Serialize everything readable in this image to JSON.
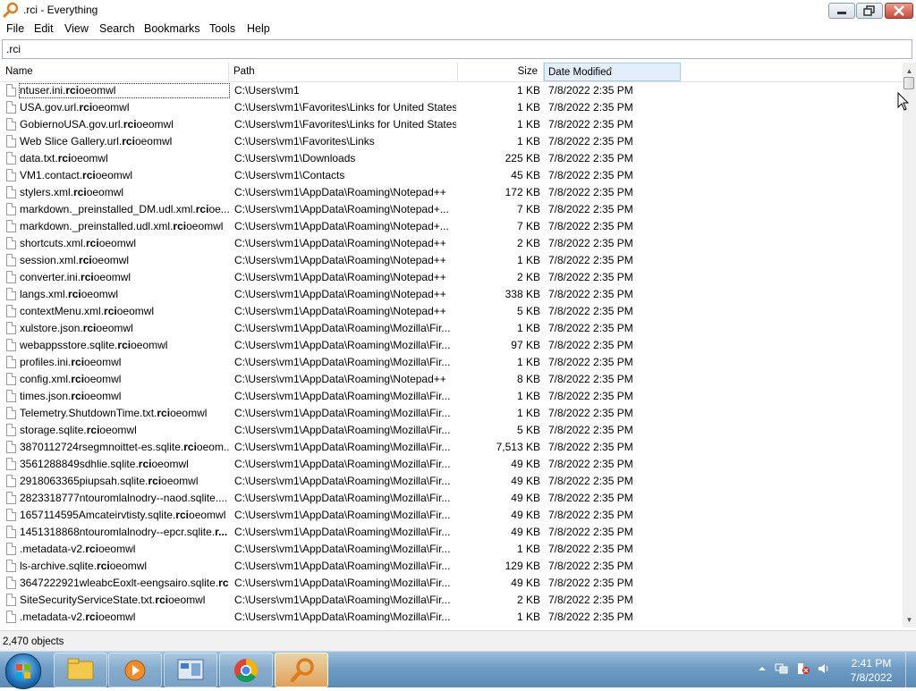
{
  "window": {
    "title": ".rci - Everything"
  },
  "menu": [
    "File",
    "Edit",
    "View",
    "Search",
    "Bookmarks",
    "Tools",
    "Help"
  ],
  "search": {
    "value": ".rci"
  },
  "columns": {
    "name": "Name",
    "path": "Path",
    "size": "Size",
    "date": "Date Modified"
  },
  "rows": [
    {
      "pre": "ntuser.ini.",
      "bold": "rci",
      "post": "oeomwl",
      "path": "C:\\Users\\vm1",
      "size": "1 KB",
      "date": "7/8/2022 2:35 PM"
    },
    {
      "pre": "USA.gov.url.",
      "bold": "rci",
      "post": "oeomwl",
      "path": "C:\\Users\\vm1\\Favorites\\Links for United States",
      "size": "1 KB",
      "date": "7/8/2022 2:35 PM"
    },
    {
      "pre": "GobiernoUSA.gov.url.",
      "bold": "rci",
      "post": "oeomwl",
      "path": "C:\\Users\\vm1\\Favorites\\Links for United States",
      "size": "1 KB",
      "date": "7/8/2022 2:35 PM"
    },
    {
      "pre": "Web Slice Gallery.url.",
      "bold": "rci",
      "post": "oeomwl",
      "path": "C:\\Users\\vm1\\Favorites\\Links",
      "size": "1 KB",
      "date": "7/8/2022 2:35 PM"
    },
    {
      "pre": "data.txt.",
      "bold": "rci",
      "post": "oeomwl",
      "path": "C:\\Users\\vm1\\Downloads",
      "size": "225 KB",
      "date": "7/8/2022 2:35 PM"
    },
    {
      "pre": "VM1.contact.",
      "bold": "rci",
      "post": "oeomwl",
      "path": "C:\\Users\\vm1\\Contacts",
      "size": "45 KB",
      "date": "7/8/2022 2:35 PM"
    },
    {
      "pre": "stylers.xml.",
      "bold": "rci",
      "post": "oeomwl",
      "path": "C:\\Users\\vm1\\AppData\\Roaming\\Notepad++",
      "size": "172 KB",
      "date": "7/8/2022 2:35 PM"
    },
    {
      "pre": "markdown._preinstalled_DM.udl.xml.",
      "bold": "rci",
      "post": "oe...",
      "path": "C:\\Users\\vm1\\AppData\\Roaming\\Notepad+...",
      "size": "7 KB",
      "date": "7/8/2022 2:35 PM"
    },
    {
      "pre": "markdown._preinstalled.udl.xml.",
      "bold": "rci",
      "post": "oeomwl",
      "path": "C:\\Users\\vm1\\AppData\\Roaming\\Notepad+...",
      "size": "7 KB",
      "date": "7/8/2022 2:35 PM"
    },
    {
      "pre": "shortcuts.xml.",
      "bold": "rci",
      "post": "oeomwl",
      "path": "C:\\Users\\vm1\\AppData\\Roaming\\Notepad++",
      "size": "2 KB",
      "date": "7/8/2022 2:35 PM"
    },
    {
      "pre": "session.xml.",
      "bold": "rci",
      "post": "oeomwl",
      "path": "C:\\Users\\vm1\\AppData\\Roaming\\Notepad++",
      "size": "1 KB",
      "date": "7/8/2022 2:35 PM"
    },
    {
      "pre": "converter.ini.",
      "bold": "rci",
      "post": "oeomwl",
      "path": "C:\\Users\\vm1\\AppData\\Roaming\\Notepad++",
      "size": "2 KB",
      "date": "7/8/2022 2:35 PM"
    },
    {
      "pre": "langs.xml.",
      "bold": "rci",
      "post": "oeomwl",
      "path": "C:\\Users\\vm1\\AppData\\Roaming\\Notepad++",
      "size": "338 KB",
      "date": "7/8/2022 2:35 PM"
    },
    {
      "pre": "contextMenu.xml.",
      "bold": "rci",
      "post": "oeomwl",
      "path": "C:\\Users\\vm1\\AppData\\Roaming\\Notepad++",
      "size": "5 KB",
      "date": "7/8/2022 2:35 PM"
    },
    {
      "pre": "xulstore.json.",
      "bold": "rci",
      "post": "oeomwl",
      "path": "C:\\Users\\vm1\\AppData\\Roaming\\Mozilla\\Fir...",
      "size": "1 KB",
      "date": "7/8/2022 2:35 PM"
    },
    {
      "pre": "webappsstore.sqlite.",
      "bold": "rci",
      "post": "oeomwl",
      "path": "C:\\Users\\vm1\\AppData\\Roaming\\Mozilla\\Fir...",
      "size": "97 KB",
      "date": "7/8/2022 2:35 PM"
    },
    {
      "pre": "profiles.ini.",
      "bold": "rci",
      "post": "oeomwl",
      "path": "C:\\Users\\vm1\\AppData\\Roaming\\Mozilla\\Fir...",
      "size": "1 KB",
      "date": "7/8/2022 2:35 PM"
    },
    {
      "pre": "config.xml.",
      "bold": "rci",
      "post": "oeomwl",
      "path": "C:\\Users\\vm1\\AppData\\Roaming\\Notepad++",
      "size": "8 KB",
      "date": "7/8/2022 2:35 PM"
    },
    {
      "pre": "times.json.",
      "bold": "rci",
      "post": "oeomwl",
      "path": "C:\\Users\\vm1\\AppData\\Roaming\\Mozilla\\Fir...",
      "size": "1 KB",
      "date": "7/8/2022 2:35 PM"
    },
    {
      "pre": "Telemetry.ShutdownTime.txt.",
      "bold": "rci",
      "post": "oeomwl",
      "path": "C:\\Users\\vm1\\AppData\\Roaming\\Mozilla\\Fir...",
      "size": "1 KB",
      "date": "7/8/2022 2:35 PM"
    },
    {
      "pre": "storage.sqlite.",
      "bold": "rci",
      "post": "oeomwl",
      "path": "C:\\Users\\vm1\\AppData\\Roaming\\Mozilla\\Fir...",
      "size": "5 KB",
      "date": "7/8/2022 2:35 PM"
    },
    {
      "pre": "3870112724rsegmnoittet-es.sqlite.",
      "bold": "rci",
      "post": "oeom...",
      "path": "C:\\Users\\vm1\\AppData\\Roaming\\Mozilla\\Fir...",
      "size": "7,513 KB",
      "date": "7/8/2022 2:35 PM"
    },
    {
      "pre": "3561288849sdhlie.sqlite.",
      "bold": "rci",
      "post": "oeomwl",
      "path": "C:\\Users\\vm1\\AppData\\Roaming\\Mozilla\\Fir...",
      "size": "49 KB",
      "date": "7/8/2022 2:35 PM"
    },
    {
      "pre": "2918063365piupsah.sqlite.",
      "bold": "rci",
      "post": "oeomwl",
      "path": "C:\\Users\\vm1\\AppData\\Roaming\\Mozilla\\Fir...",
      "size": "49 KB",
      "date": "7/8/2022 2:35 PM"
    },
    {
      "pre": "2823318777ntouromlalnodry--naod.sqlite....",
      "bold": "",
      "post": "",
      "path": "C:\\Users\\vm1\\AppData\\Roaming\\Mozilla\\Fir...",
      "size": "49 KB",
      "date": "7/8/2022 2:35 PM"
    },
    {
      "pre": "1657114595Amcateirvtisty.sqlite.",
      "bold": "rci",
      "post": "oeomwl",
      "path": "C:\\Users\\vm1\\AppData\\Roaming\\Mozilla\\Fir...",
      "size": "49 KB",
      "date": "7/8/2022 2:35 PM"
    },
    {
      "pre": "1451318868ntouromlalnodry--epcr.sqlite.",
      "bold": "r...",
      "post": "",
      "path": "C:\\Users\\vm1\\AppData\\Roaming\\Mozilla\\Fir...",
      "size": "49 KB",
      "date": "7/8/2022 2:35 PM"
    },
    {
      "pre": ".metadata-v2.",
      "bold": "rci",
      "post": "oeomwl",
      "path": "C:\\Users\\vm1\\AppData\\Roaming\\Mozilla\\Fir...",
      "size": "1 KB",
      "date": "7/8/2022 2:35 PM"
    },
    {
      "pre": "ls-archive.sqlite.",
      "bold": "rci",
      "post": "oeomwl",
      "path": "C:\\Users\\vm1\\AppData\\Roaming\\Mozilla\\Fir...",
      "size": "129 KB",
      "date": "7/8/2022 2:35 PM"
    },
    {
      "pre": "3647222921wleabcEoxlt-eengsairo.sqlite.",
      "bold": "rc...",
      "post": "",
      "path": "C:\\Users\\vm1\\AppData\\Roaming\\Mozilla\\Fir...",
      "size": "49 KB",
      "date": "7/8/2022 2:35 PM"
    },
    {
      "pre": "SiteSecurityServiceState.txt.",
      "bold": "rci",
      "post": "oeomwl",
      "path": "C:\\Users\\vm1\\AppData\\Roaming\\Mozilla\\Fir...",
      "size": "2 KB",
      "date": "7/8/2022 2:35 PM"
    },
    {
      "pre": ".metadata-v2.",
      "bold": "rci",
      "post": "oeomwl",
      "path": "C:\\Users\\vm1\\AppData\\Roaming\\Mozilla\\Fir...",
      "size": "1 KB",
      "date": "7/8/2022 2:35 PM"
    }
  ],
  "status": {
    "text": "2,470 objects"
  },
  "taskbar": {
    "apps": [
      "Windows Explorer",
      "Windows Media Player",
      "Control Panel",
      "Google Chrome",
      "Everything"
    ],
    "time": "2:41 PM",
    "date": "7/8/2022"
  },
  "colors": {
    "accent": "#e2eef9",
    "taskbar": "#6e9cc3",
    "app_icon": "#e07b1a"
  }
}
